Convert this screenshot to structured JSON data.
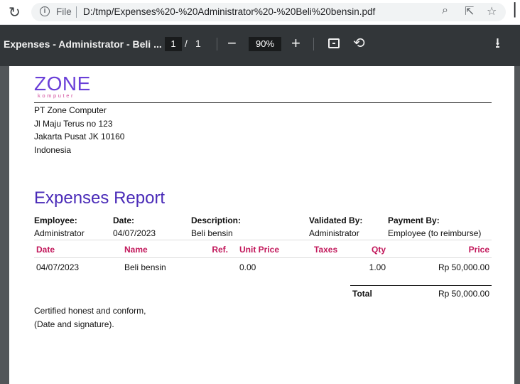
{
  "browser": {
    "file_label": "File",
    "url": "D:/tmp/Expenses%20-%20Administrator%20-%20Beli%20bensin.pdf"
  },
  "pdf_toolbar": {
    "title": "Expenses - Administrator - Beli ...",
    "page_current": "1",
    "page_separator": "/",
    "page_total": "1",
    "zoom": "90%"
  },
  "company": {
    "logo_main": "ZONE",
    "logo_sub": "komputer",
    "name": "PT Zone Computer",
    "street": "Jl Maju Terus no 123",
    "city": "Jakarta Pusat JK 10160",
    "country": "Indonesia"
  },
  "report": {
    "title": "Expenses Report",
    "info": [
      {
        "label": "Employee:",
        "value": "Administrator"
      },
      {
        "label": "Date:",
        "value": "04/07/2023"
      },
      {
        "label": "Description:",
        "value": "Beli bensin"
      },
      {
        "label": "Validated By:",
        "value": "Administrator"
      },
      {
        "label": "Payment By:",
        "value": "Employee (to reimburse)"
      }
    ],
    "columns": [
      "Date",
      "Name",
      "Ref.",
      "Unit Price",
      "Taxes",
      "Qty",
      "Price"
    ],
    "rows": [
      {
        "date": "04/07/2023",
        "name": "Beli bensin",
        "ref": "",
        "unit_price": "0.00",
        "taxes": "",
        "qty": "1.00",
        "price": "Rp 50,000.00"
      }
    ],
    "total_label": "Total",
    "total_value": "Rp 50,000.00",
    "cert_line1": "Certified honest and conform,",
    "cert_line2": "(Date and signature)."
  },
  "colors": {
    "accent_title": "#4a2bb8",
    "table_header": "#c2185b",
    "toolbar_bg": "#323639",
    "viewer_bg": "#525659"
  }
}
